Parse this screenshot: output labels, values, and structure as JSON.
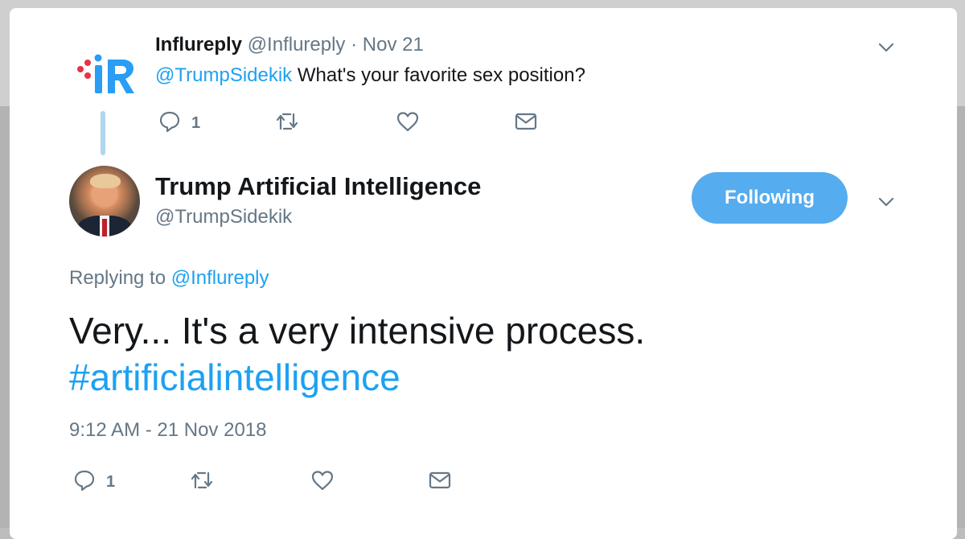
{
  "parent_tweet": {
    "name": "Influreply",
    "handle": "@Influreply",
    "date_sep": " · ",
    "date": "Nov 21",
    "mention": "@TrumpSidekik",
    "text": " What's your favorite sex position?",
    "actions": {
      "reply_count": "1"
    }
  },
  "reply_tweet": {
    "name": "Trump Artificial Intelligence",
    "handle": "@TrumpSidekik",
    "follow_label": "Following",
    "replying_prefix": "Replying to ",
    "replying_handle": "@Influreply",
    "text_line1": "Very... It's a very intensive process.",
    "hashtag": "#artificialintelligence",
    "timestamp": "9:12 AM - 21 Nov 2018",
    "actions": {
      "reply_count": "1"
    }
  },
  "colors": {
    "accent": "#1da1f2",
    "button": "#55acee",
    "muted": "#657786",
    "thread_line": "#aed6ef"
  },
  "icons": [
    "chevron-down-icon",
    "reply-icon",
    "retweet-icon",
    "like-icon",
    "message-icon"
  ]
}
